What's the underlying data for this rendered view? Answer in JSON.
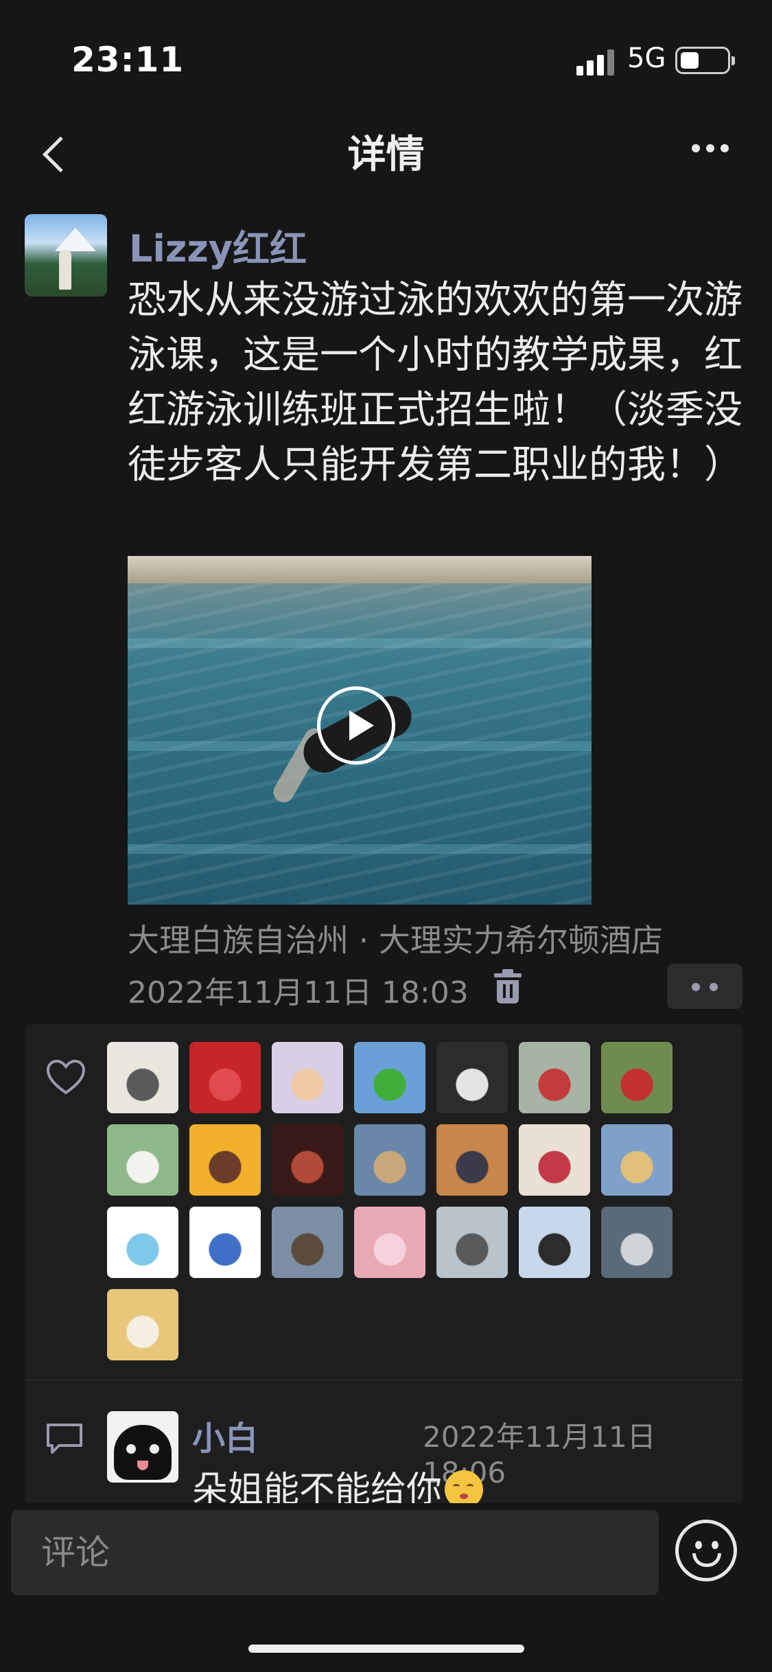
{
  "status_bar": {
    "time": "23:11",
    "network": "5G"
  },
  "nav": {
    "title": "详情"
  },
  "post": {
    "author": "Lizzy红红",
    "text": "恐水从来没游过泳的欢欢的第一次游泳课，这是一个小时的教学成果，红红游泳训练班正式招生啦！（淡季没徒步客人只能开发第二职业的我！）",
    "location": "大理白族自治州 · 大理实力希尔顿酒店",
    "timestamp": "2022年11月11日 18:03"
  },
  "likes": {
    "avatars": [
      {
        "name": "like-avatar-penguins",
        "bg": "#e9e6e0",
        "accent": "#5a5a5a"
      },
      {
        "name": "like-avatar-red",
        "bg": "#c8252a",
        "accent": "#e14a4e"
      },
      {
        "name": "like-avatar-girl-flowers",
        "bg": "#d8cfe6",
        "accent": "#f0c9a6"
      },
      {
        "name": "like-avatar-frog",
        "bg": "#6a9fd8",
        "accent": "#3fae3a"
      },
      {
        "name": "like-avatar-cat-gray",
        "bg": "#2c2c2c",
        "accent": "#e4e4e4"
      },
      {
        "name": "like-avatar-cyclist",
        "bg": "#a7b3a5",
        "accent": "#c43b3b"
      },
      {
        "name": "like-avatar-man-trophy",
        "bg": "#6f8c4f",
        "accent": "#c2302f"
      },
      {
        "name": "like-avatar-white-dog",
        "bg": "#8fb88a",
        "accent": "#f4f2ee"
      },
      {
        "name": "like-avatar-cartoon-girl",
        "bg": "#f3b02b",
        "accent": "#6a3c2a"
      },
      {
        "name": "like-avatar-dark-portrait",
        "bg": "#3a1a18",
        "accent": "#b24a3a"
      },
      {
        "name": "like-avatar-canal",
        "bg": "#6a86a8",
        "accent": "#c9a77a"
      },
      {
        "name": "like-avatar-sunset",
        "bg": "#c9864a",
        "accent": "#3a3a4a"
      },
      {
        "name": "like-avatar-flowers-vase",
        "bg": "#e9e1d4",
        "accent": "#c2394a"
      },
      {
        "name": "like-avatar-golden-dog",
        "bg": "#7fa0c9",
        "accent": "#e2c07a"
      },
      {
        "name": "like-avatar-squirtle",
        "bg": "#ffffff",
        "accent": "#7ec8ea"
      },
      {
        "name": "like-avatar-stitch",
        "bg": "#ffffff",
        "accent": "#3f6fc6"
      },
      {
        "name": "like-avatar-mountain-sit",
        "bg": "#7b8ea6",
        "accent": "#5b4b3a"
      },
      {
        "name": "like-avatar-pink-party",
        "bg": "#e8a8b4",
        "accent": "#f6d2dc"
      },
      {
        "name": "like-avatar-beach-man",
        "bg": "#b9c3cb",
        "accent": "#5a5a5a"
      },
      {
        "name": "like-avatar-snow-girl",
        "bg": "#c8d8ea",
        "accent": "#2c2c2c"
      },
      {
        "name": "like-avatar-volcano",
        "bg": "#5a6a7a",
        "accent": "#d0d4d8"
      },
      {
        "name": "like-avatar-orange-cat",
        "bg": "#e8c77a",
        "accent": "#f4efe2"
      }
    ]
  },
  "comments": [
    {
      "author": "小白",
      "time": "2022年11月11日 18:06",
      "text": "朵姐能不能给你"
    }
  ],
  "comment_input": {
    "placeholder": "评论"
  }
}
